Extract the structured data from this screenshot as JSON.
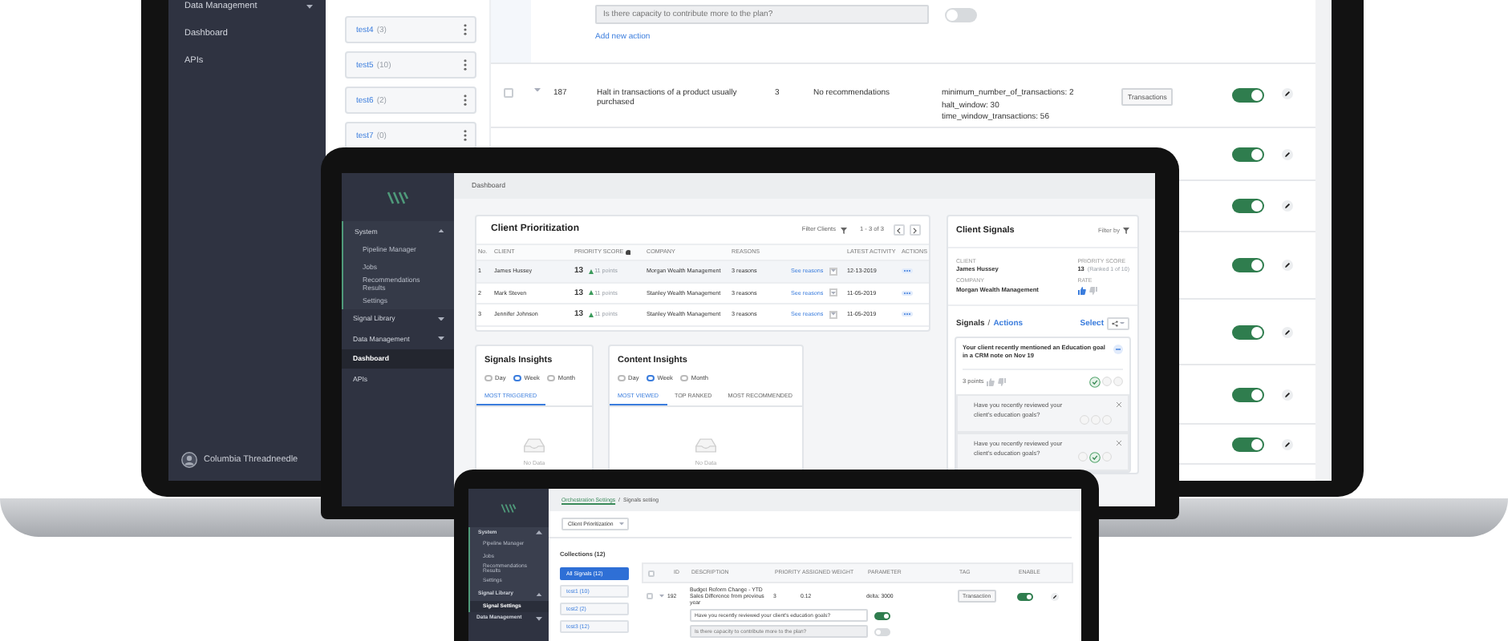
{
  "back_screen": {
    "sidebar": [
      {
        "label": "Data Management",
        "expanded": false
      },
      {
        "label": "Dashboard"
      },
      {
        "label": "APIs"
      }
    ],
    "user": "Columbia Threadneedle",
    "collections": [
      {
        "name": "test4",
        "count": "(3)"
      },
      {
        "name": "test5",
        "count": "(10)"
      },
      {
        "name": "test6",
        "count": "(2)"
      },
      {
        "name": "test7",
        "count": "(0)"
      }
    ],
    "action_input": {
      "placeholder": "Is there capacity to contribute more to the plan?",
      "disabled": true,
      "on": false
    },
    "add_action": "Add new action",
    "rows": [
      {
        "checked": false,
        "id": "187",
        "description": "Halt in transactions of a product usually purchased",
        "priority": "3",
        "recommendations": "No recommendations",
        "parameters": [
          "minimum_number_of_transactions: 2",
          "halt_window: 30",
          "time_window_transactions: 56"
        ],
        "tag": "Transactions",
        "enabled": true
      },
      {
        "enabled": true
      },
      {
        "enabled": true
      },
      {
        "enabled": true
      },
      {
        "enabled": true
      },
      {
        "enabled": true
      },
      {
        "enabled": true
      }
    ]
  },
  "middle_screen": {
    "sidebar": [
      {
        "label": "System",
        "expanded": true,
        "selected": false,
        "children": [
          {
            "label": "Pipeline Manager",
            "selected": false
          },
          {
            "label": "Jobs",
            "selected": false
          },
          {
            "label": "Recommendations Results",
            "selected": false
          },
          {
            "label": "Settings",
            "selected": false
          }
        ]
      },
      {
        "label": "Signal Library",
        "expanded": false,
        "selected": false
      },
      {
        "label": "Data Management",
        "expanded": false,
        "selected": false
      },
      {
        "label": "Dashboard",
        "selected": true
      },
      {
        "label": "APIs",
        "selected": false
      }
    ],
    "breadcrumb": "Dashboard",
    "client_prioritization": {
      "title": "Client Prioritization",
      "filter": "Filter Clients",
      "pagination": "1 - 3 of 3",
      "columns": [
        "No.",
        "CLIENT",
        "PRIORITY SCORE",
        "COMPANY",
        "REASONS",
        "LATEST ACTIVITY",
        "ACTIONS"
      ],
      "rows": [
        {
          "no": "1",
          "client": "James Hussey",
          "score": "13",
          "change": "11 points",
          "company": "Morgan Wealth Management",
          "reasons": "3 reasons",
          "link": "See reasons",
          "date": "12-13-2019",
          "selected": true
        },
        {
          "no": "2",
          "client": "Mark Steven",
          "score": "13",
          "change": "11 points",
          "company": "Stanley Wealth Management",
          "reasons": "3 reasons",
          "link": "See reasons",
          "date": "11-05-2019",
          "selected": false
        },
        {
          "no": "3",
          "client": "Jennifer Johnson",
          "score": "13",
          "change": "11 points",
          "company": "Stanley Wealth Management",
          "reasons": "3 reasons",
          "link": "See reasons",
          "date": "11-05-2019",
          "selected": false
        }
      ]
    },
    "insights": [
      {
        "title": "Signals Insights",
        "periods": [
          {
            "label": "Day",
            "selected": false
          },
          {
            "label": "Week",
            "selected": true
          },
          {
            "label": "Month",
            "selected": false
          }
        ],
        "tabs": [
          {
            "label": "MOST TRIGGERED",
            "selected": true
          }
        ],
        "empty": "No Data"
      },
      {
        "title": "Content Insights",
        "periods": [
          {
            "label": "Day",
            "selected": false
          },
          {
            "label": "Week",
            "selected": true
          },
          {
            "label": "Month",
            "selected": false
          }
        ],
        "tabs": [
          {
            "label": "MOST VIEWED",
            "selected": true
          },
          {
            "label": "TOP RANKED",
            "selected": false
          },
          {
            "label": "MOST RECOMMENDED",
            "selected": false
          }
        ],
        "empty": "No Data"
      }
    ],
    "client_signals": {
      "title": "Client Signals",
      "filter": "Filter by",
      "client_label": "CLIENT",
      "client": "James Hussey",
      "score_label": "PRIORITY SCORE",
      "score": "13",
      "rank": "(Ranked 1 of 10)",
      "company_label": "COMPANY",
      "company": "Morgan Wealth Management",
      "rate_label": "RATE",
      "signals_title": "Signals",
      "separator": "/",
      "actions_title": "Actions",
      "select": "Select",
      "signal": {
        "text": "Your client recently mentioned an Education goal in a CRM note on Nov 19",
        "points": "3 points"
      },
      "actions": [
        {
          "text": "Have you recently reviewed your client's education goals?"
        },
        {
          "text": "Have you recently reviewed your client's education goals?"
        }
      ]
    }
  },
  "front_screen": {
    "sidebar": [
      {
        "label": "System",
        "expanded": true,
        "selected": false,
        "children": [
          {
            "label": "Pipeline Manager",
            "selected": false
          },
          {
            "label": "Jobs",
            "selected": false
          },
          {
            "label": "Recommendations Results",
            "selected": false
          },
          {
            "label": "Settings",
            "selected": false
          }
        ]
      },
      {
        "label": "Signal Library",
        "expanded": true,
        "selected": false,
        "children": [
          {
            "label": "Signal Settings",
            "selected": true
          }
        ]
      },
      {
        "label": "Data Management",
        "expanded": false,
        "selected": false
      }
    ],
    "breadcrumb_link": "Orchestration Settings",
    "breadcrumb_separator": "/",
    "breadcrumb_current": "Signals setting",
    "model_select": "Client Prioritization",
    "collections_title": "Collections (12)",
    "collections": [
      {
        "name": "All Signals (12)",
        "selected": true
      },
      {
        "name": "test1 (10)",
        "selected": false
      },
      {
        "name": "test2 (2)",
        "selected": false
      },
      {
        "name": "test3 (12)",
        "selected": false
      }
    ],
    "select_all_checked": false,
    "columns": [
      "ID",
      "DESCRIPTION",
      "PRIORITY",
      "ASSIGNED WEIGHT",
      "PARAMETER",
      "TAG",
      "ENABLE"
    ],
    "row": {
      "checked": false,
      "id": "192",
      "description": "Budget Reform Change - YTD Sales Difference from previous year",
      "priority": "3",
      "weight": "0.12",
      "parameter": "delta: 3000",
      "tag": "Transaction",
      "enabled": true
    },
    "actions": [
      {
        "value": "Have you recently reviewed your client's education goals?",
        "disabled": false,
        "on": true
      },
      {
        "placeholder": "Is there capacity to contribute more to the plan?",
        "disabled": true,
        "on": false
      }
    ]
  }
}
